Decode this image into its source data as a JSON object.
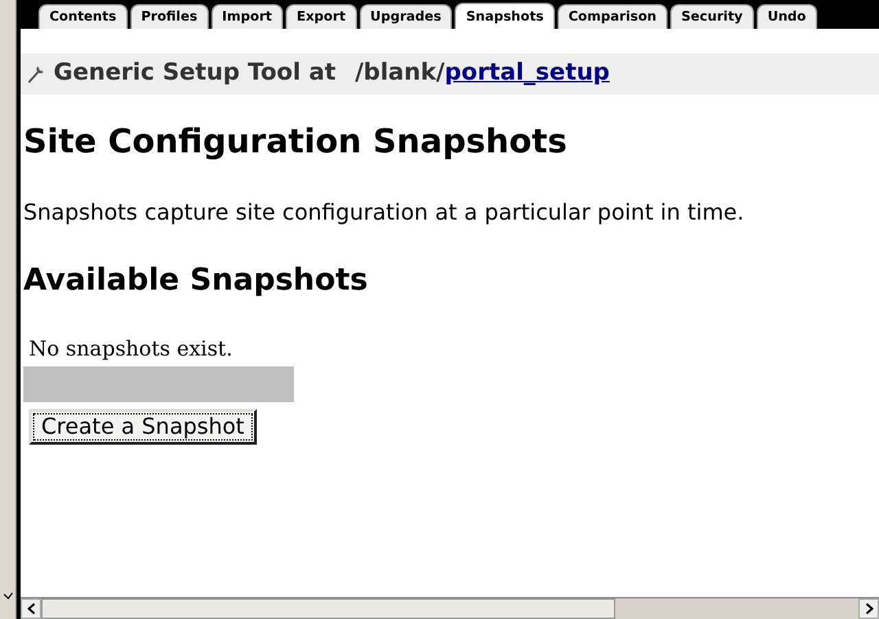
{
  "tabs": [
    {
      "label": "Contents",
      "selected": false
    },
    {
      "label": "Profiles",
      "selected": false
    },
    {
      "label": "Import",
      "selected": false
    },
    {
      "label": "Export",
      "selected": false
    },
    {
      "label": "Upgrades",
      "selected": false
    },
    {
      "label": "Snapshots",
      "selected": true
    },
    {
      "label": "Comparison",
      "selected": false
    },
    {
      "label": "Security",
      "selected": false
    },
    {
      "label": "Undo",
      "selected": false
    }
  ],
  "header": {
    "title": "Generic Setup Tool at",
    "path_prefix": "/blank",
    "separator": "/",
    "path_link": "portal_setup"
  },
  "heading": "Site Configuration Snapshots",
  "description": "Snapshots capture site configuration at a particular point in time.",
  "subheading": "Available Snapshots",
  "empty_message": "No snapshots exist.",
  "button": "Create a Snapshot"
}
